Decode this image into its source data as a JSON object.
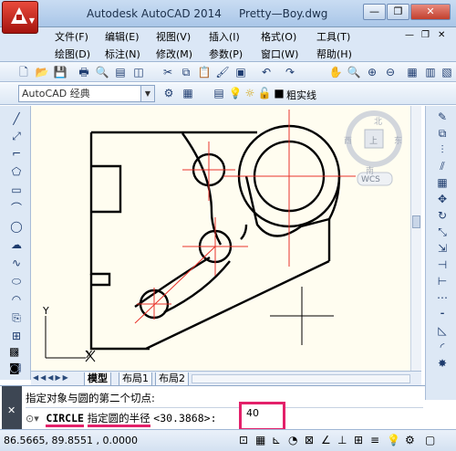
{
  "app": {
    "title": "Autodesk AutoCAD 2014",
    "document": "Pretty—Boy.dwg"
  },
  "window_buttons": {
    "minimize": "—",
    "restore": "❐",
    "close": "✕"
  },
  "menu": {
    "row1": [
      "文件(F)",
      "编辑(E)",
      "视图(V)",
      "插入(I)",
      "格式(O)",
      "工具(T)"
    ],
    "row2": [
      "绘图(D)",
      "标注(N)",
      "修改(M)",
      "参数(P)",
      "窗口(W)",
      "帮助(H)"
    ],
    "mdi_buttons": [
      "—",
      "❐",
      "✕"
    ]
  },
  "toolbar2": {
    "workspace": "AutoCAD 经典",
    "linetype": "粗实线"
  },
  "viewcube": {
    "top_label": "北",
    "bottom_label": "南",
    "left_label": "西",
    "right_label": "东",
    "center_label": "上",
    "wcs_label": "WCS"
  },
  "ucs": {
    "x_label": "X",
    "y_label": "Y"
  },
  "tabs": [
    "模型",
    "布局1",
    "布局2"
  ],
  "command": {
    "history": "指定对象与圆的第二个切点:",
    "command_name": "CIRCLE",
    "prompt": "指定圆的半径",
    "default_value": "<30.3868>:",
    "input_value": "40"
  },
  "status": {
    "coordinates": "86.5665,  89.8551 , 0.0000"
  },
  "colors": {
    "accent_pink": "#e3206a",
    "canvas_bg": "#fffdf0",
    "centerline": "#e8332b"
  }
}
